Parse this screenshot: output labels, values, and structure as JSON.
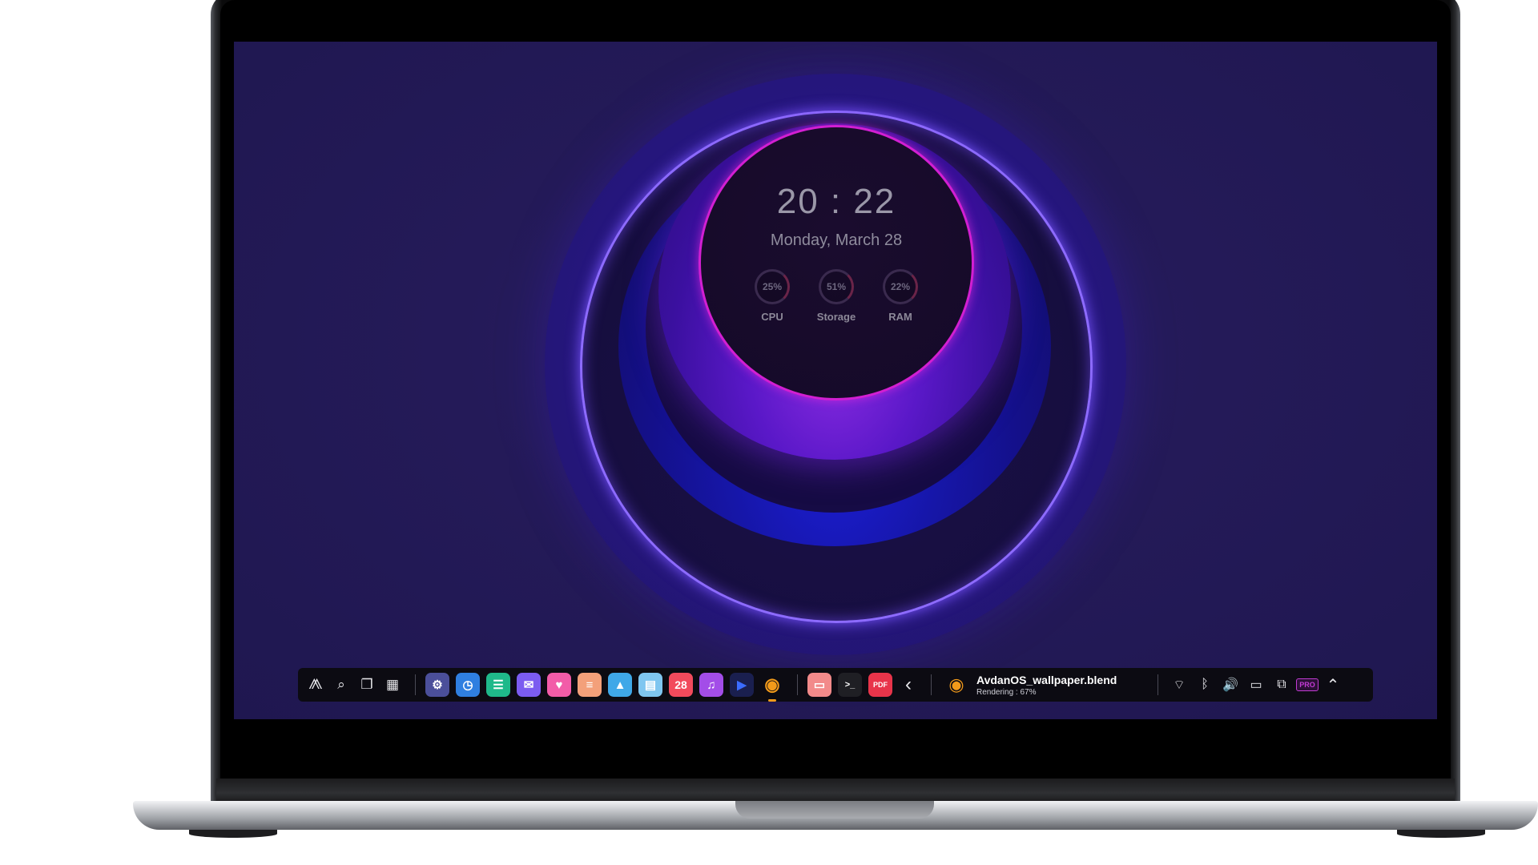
{
  "widget": {
    "time": "20 : 22",
    "date": "Monday, March 28",
    "stats": [
      {
        "value": "25%",
        "label": "CPU"
      },
      {
        "value": "51%",
        "label": "Storage"
      },
      {
        "value": "22%",
        "label": "RAM"
      }
    ]
  },
  "taskbar": {
    "system": [
      {
        "name": "launcher-icon",
        "glyph": "⨇"
      },
      {
        "name": "search-icon",
        "glyph": "⌕"
      },
      {
        "name": "task-view-icon",
        "glyph": "❐"
      },
      {
        "name": "widgets-icon",
        "glyph": "▦"
      }
    ],
    "apps": [
      {
        "name": "settings-icon",
        "glyph": "⚙",
        "color": "#4b4f9a"
      },
      {
        "name": "clock-icon",
        "glyph": "◷",
        "color": "#2f7fe0"
      },
      {
        "name": "messages-icon",
        "glyph": "☰",
        "color": "#1fb98a"
      },
      {
        "name": "mail-icon",
        "glyph": "✉",
        "color": "#7b5cf0"
      },
      {
        "name": "store-icon",
        "glyph": "♥",
        "color": "#f25ca8"
      },
      {
        "name": "notes-icon",
        "glyph": "≡",
        "color": "#f3a07a"
      },
      {
        "name": "photos-icon",
        "glyph": "▲",
        "color": "#3fa8e8"
      },
      {
        "name": "calculator-icon",
        "glyph": "▤",
        "color": "#7fc6f0"
      },
      {
        "name": "calendar-icon",
        "glyph": "28",
        "color": "#f24a5c"
      },
      {
        "name": "music-icon",
        "glyph": "♫",
        "color": "#a34de8"
      },
      {
        "name": "video-player-icon",
        "glyph": "▶",
        "color": "#1a1f4f"
      },
      {
        "name": "blender-icon",
        "glyph": "◉",
        "color": "#f29a1a",
        "active": true
      }
    ],
    "pinned": [
      {
        "name": "files-icon",
        "glyph": "▭",
        "color": "#f28a8a"
      },
      {
        "name": "terminal-icon",
        "glyph": ">_",
        "color": "#1f1f24"
      },
      {
        "name": "pdf-icon",
        "glyph": "PDF",
        "color": "#e8344a"
      }
    ],
    "collapse_glyph": "‹",
    "render_task": {
      "title": "AvdanOS_wallpaper.blend",
      "subtitle": "Rendering :  67%"
    },
    "tray": [
      {
        "name": "wifi-icon",
        "glyph": "⌔"
      },
      {
        "name": "bluetooth-icon",
        "glyph": "ᛒ"
      },
      {
        "name": "volume-icon",
        "glyph": "🔊"
      },
      {
        "name": "battery-icon",
        "glyph": "▭"
      },
      {
        "name": "windows-icon",
        "glyph": "⧉"
      }
    ],
    "pro_badge": "PRO",
    "expand_glyph": "⌃"
  }
}
